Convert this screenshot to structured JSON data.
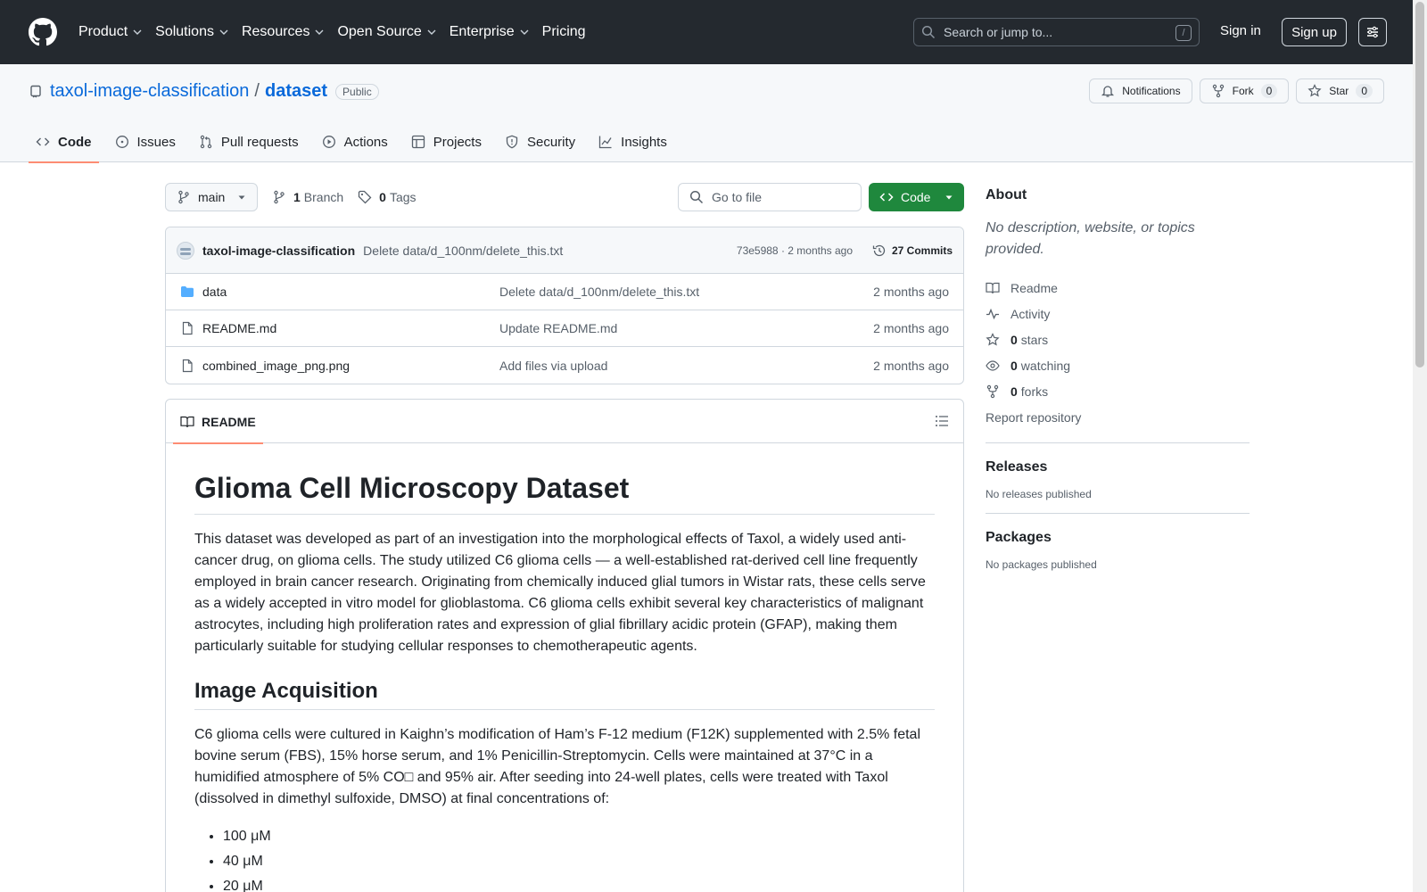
{
  "header": {
    "nav": [
      {
        "label": "Product",
        "dropdown": true
      },
      {
        "label": "Solutions",
        "dropdown": true
      },
      {
        "label": "Resources",
        "dropdown": true
      },
      {
        "label": "Open Source",
        "dropdown": true
      },
      {
        "label": "Enterprise",
        "dropdown": true
      },
      {
        "label": "Pricing",
        "dropdown": false
      }
    ],
    "search_placeholder": "Search or jump to...",
    "search_key": "/",
    "signin": "Sign in",
    "signup": "Sign up"
  },
  "repo": {
    "owner": "taxol-image-classification",
    "separator": "/",
    "name": "dataset",
    "visibility": "Public",
    "actions": {
      "notifications": "Notifications",
      "fork": "Fork",
      "fork_count": "0",
      "star": "Star",
      "star_count": "0"
    },
    "tabs": [
      "Code",
      "Issues",
      "Pull requests",
      "Actions",
      "Projects",
      "Security",
      "Insights"
    ]
  },
  "toolbar": {
    "branch": "main",
    "branch_count": "1",
    "branch_label": "Branch",
    "tag_count": "0",
    "tag_label": "Tags",
    "goto_placeholder": "Go to file",
    "code_label": "Code"
  },
  "commit": {
    "author": "taxol-image-classification",
    "message": "Delete data/d_100nm/delete_this.txt",
    "meta": "73e5988 · 2 months ago",
    "commits": "27 Commits"
  },
  "files": [
    {
      "name": "data",
      "type": "folder",
      "commit": "Delete data/d_100nm/delete_this.txt",
      "age": "2 months ago"
    },
    {
      "name": "README.md",
      "type": "file",
      "commit": "Update README.md",
      "age": "2 months ago"
    },
    {
      "name": "combined_image_png.png",
      "type": "file",
      "commit": "Add files via upload",
      "age": "2 months ago"
    }
  ],
  "readme": {
    "tab": "README",
    "h1": "Glioma Cell Microscopy Dataset",
    "p1": "This dataset was developed as part of an investigation into the morphological effects of Taxol, a widely used anti-cancer drug, on glioma cells. The study utilized C6 glioma cells — a well-established rat-derived cell line frequently employed in brain cancer research. Originating from chemically induced glial tumors in Wistar rats, these cells serve as a widely accepted in vitro model for glioblastoma. C6 glioma cells exhibit several key characteristics of malignant astrocytes, including high proliferation rates and expression of glial fibrillary acidic protein (GFAP), making them particularly suitable for studying cellular responses to chemotherapeutic agents.",
    "h2": "Image Acquisition",
    "p2": "C6 glioma cells were cultured in Kaighn’s modification of Ham’s F-12 medium (F12K) supplemented with 2.5% fetal bovine serum (FBS), 15% horse serum, and 1% Penicillin-Streptomycin. Cells were maintained at 37°C in a humidified atmosphere of 5% CO□ and 95% air. After seeding into 24-well plates, cells were treated with Taxol (dissolved in dimethyl sulfoxide, DMSO) at final concentrations of:",
    "list": [
      "100 μM",
      "40 μM",
      "20 μM"
    ]
  },
  "about": {
    "title": "About",
    "description": "No description, website, or topics provided.",
    "readme": "Readme",
    "activity": "Activity",
    "stars_count": "0",
    "stars_label": "stars",
    "watching_count": "0",
    "watching_label": "watching",
    "forks_count": "0",
    "forks_label": "forks",
    "report": "Report repository"
  },
  "releases": {
    "title": "Releases",
    "empty": "No releases published"
  },
  "packages": {
    "title": "Packages",
    "empty": "No packages published"
  },
  "colors": {
    "header_bg": "#24292f",
    "accent": "#0969da",
    "primary_button": "#1f883d",
    "tab_underline": "#fd8c73",
    "folder": "#54aeff"
  }
}
